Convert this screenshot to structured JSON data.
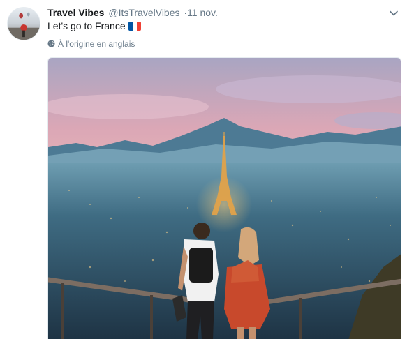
{
  "tweet": {
    "author_name": "Travel Vibes",
    "author_handle": "@ItsTravelVibes",
    "separator": "·",
    "timestamp": "11 nov.",
    "text": "Let's go to France",
    "flag_icon": "france-flag-icon",
    "translate_label": "À l'origine en anglais",
    "translate_icon": "globe-icon",
    "menu_icon": "chevron-down-icon",
    "media_alt": "couple looking at Eiffel Tower over Paris"
  },
  "colors": {
    "text_primary": "#14171a",
    "text_secondary": "#657786",
    "flag_blue": "#0055a4",
    "flag_white": "#ffffff",
    "flag_red": "#ef4135"
  }
}
